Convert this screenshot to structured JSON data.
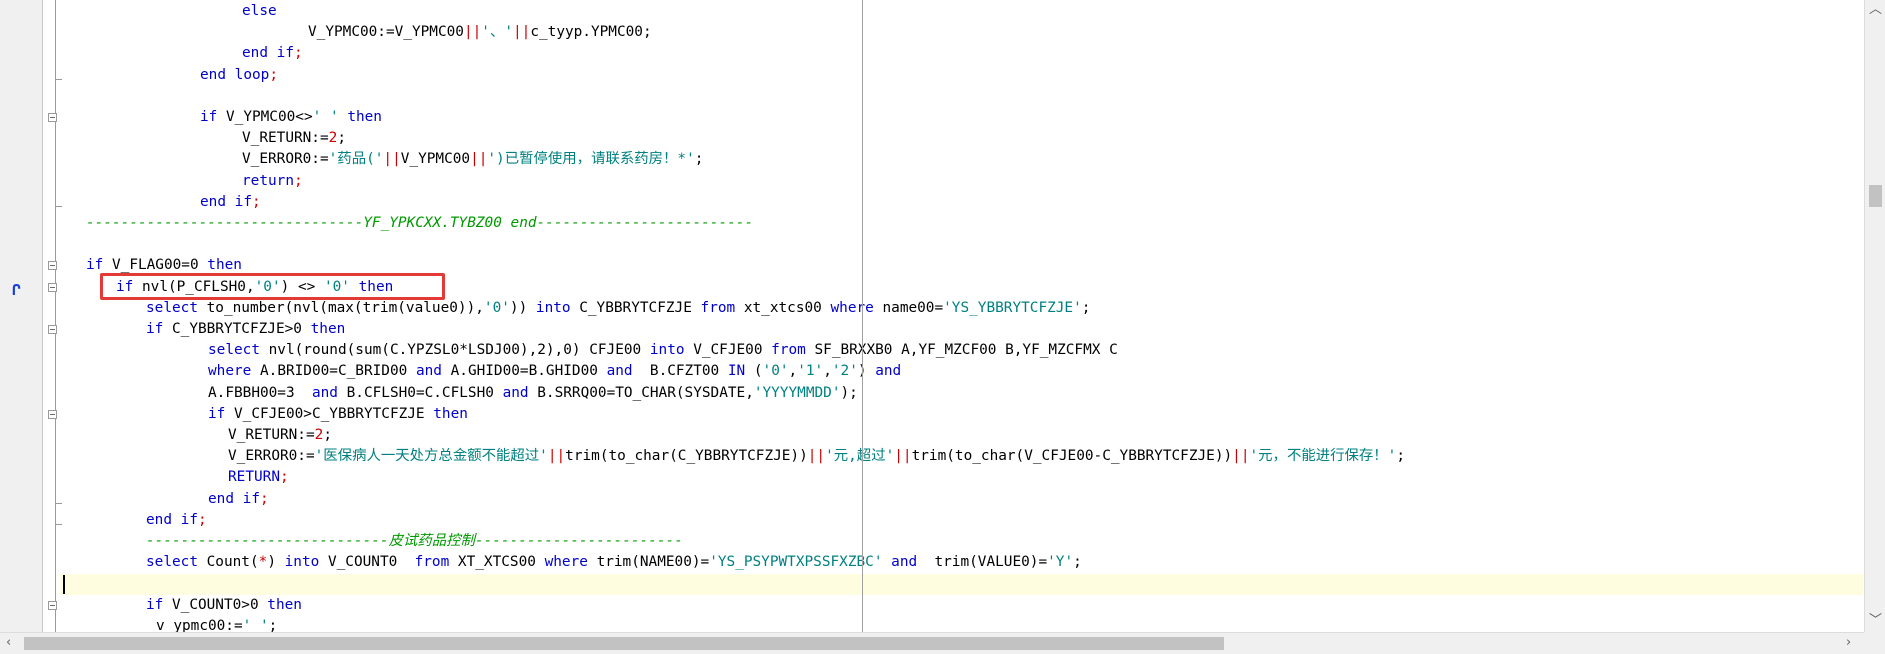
{
  "editor": {
    "colors": {
      "keyword": "#0000cc",
      "operator": "#cc0000",
      "string": "#008080",
      "comment": "#009900",
      "highlight_box": "#e53935",
      "current_line": "#fffde0"
    },
    "icons": {
      "bookmark": "bookmark-icon",
      "fold": "fold-minus-icon",
      "scroll_up": "chevron-up-icon",
      "scroll_down": "chevron-down-icon",
      "scroll_left": "chevron-left-icon",
      "scroll_right": "chevron-right-icon"
    },
    "highlighted_line_index": 13,
    "current_line_index": 27,
    "lines": [
      [
        [
          "kw",
          "else"
        ]
      ],
      [
        [
          "t",
          "V_YPMC00:=V_YPMC00"
        ],
        [
          "op",
          "||"
        ],
        [
          "str",
          "'、'"
        ],
        [
          "op",
          "||"
        ],
        [
          "t",
          "c_tyyp.YPMC00;"
        ]
      ],
      [
        [
          "kw",
          "end if"
        ],
        [
          "op",
          ";"
        ]
      ],
      [
        [
          "kw",
          "end loop"
        ],
        [
          "op",
          ";"
        ]
      ],
      [],
      [
        [
          "kw",
          "if"
        ],
        [
          "t",
          " V_YPMC00<>"
        ],
        [
          "str",
          "' '"
        ],
        [
          "t",
          " "
        ],
        [
          "kw",
          "then"
        ]
      ],
      [
        [
          "t",
          "V_RETURN:="
        ],
        [
          "op",
          "2"
        ],
        [
          "t",
          ";"
        ]
      ],
      [
        [
          "t",
          "V_ERROR0:="
        ],
        [
          "str",
          "'药品('"
        ],
        [
          "op",
          "||"
        ],
        [
          "t",
          "V_YPMC00"
        ],
        [
          "op",
          "||"
        ],
        [
          "str",
          "')已暂停使用，请联系药房！*'"
        ],
        [
          "t",
          ";"
        ]
      ],
      [
        [
          "kw",
          "return"
        ],
        [
          "op",
          ";"
        ]
      ],
      [
        [
          "kw",
          "end if"
        ],
        [
          "op",
          ";"
        ]
      ],
      [
        [
          "cm",
          "--------------------------------YF_YPKCXX.TYBZ00 end-------------------------"
        ]
      ],
      [],
      [
        [
          "kw",
          "if"
        ],
        [
          "t",
          " V_FLAG00=0 "
        ],
        [
          "kw",
          "then"
        ]
      ],
      [
        [
          "kw",
          "if"
        ],
        [
          "t",
          " nvl(P_CFLSH0,"
        ],
        [
          "str",
          "'0'"
        ],
        [
          "t",
          ") <> "
        ],
        [
          "str",
          "'0'"
        ],
        [
          "t",
          " "
        ],
        [
          "kw",
          "then"
        ]
      ],
      [
        [
          "kw",
          "select"
        ],
        [
          "t",
          " to_number(nvl(max(trim(value0)),"
        ],
        [
          "str",
          "'0'"
        ],
        [
          "t",
          ")) "
        ],
        [
          "kw",
          "into"
        ],
        [
          "t",
          " C_YBBRYTCFZJE "
        ],
        [
          "kw",
          "from"
        ],
        [
          "t",
          " xt_xtcs00 "
        ],
        [
          "kw",
          "where"
        ],
        [
          "t",
          " name00="
        ],
        [
          "str",
          "'YS_YBBRYTCFZJE'"
        ],
        [
          "t",
          ";"
        ]
      ],
      [
        [
          "kw",
          "if"
        ],
        [
          "t",
          " C_YBBRYTCFZJE>0 "
        ],
        [
          "kw",
          "then"
        ]
      ],
      [
        [
          "kw",
          "select"
        ],
        [
          "t",
          " nvl(round(sum(C.YPZSL0*LSDJ00),2),0) CFJE00 "
        ],
        [
          "kw",
          "into"
        ],
        [
          "t",
          " V_CFJE00 "
        ],
        [
          "kw",
          "from"
        ],
        [
          "t",
          " SF_BRXXB0 A,YF_MZCF00 B,YF_MZCFMX C"
        ]
      ],
      [
        [
          "kw",
          "where"
        ],
        [
          "t",
          " A.BRID00=C_BRID00 "
        ],
        [
          "kw",
          "and"
        ],
        [
          "t",
          " A.GHID00=B.GHID00 "
        ],
        [
          "kw",
          "and"
        ],
        [
          "t",
          "  B.CFZT00 "
        ],
        [
          "kw",
          "IN"
        ],
        [
          "t",
          " ("
        ],
        [
          "str",
          "'0'"
        ],
        [
          "t",
          ","
        ],
        [
          "str",
          "'1'"
        ],
        [
          "t",
          ","
        ],
        [
          "str",
          "'2'"
        ],
        [
          "t",
          ") "
        ],
        [
          "kw",
          "and"
        ]
      ],
      [
        [
          "t",
          "A.FBBH00=3  "
        ],
        [
          "kw",
          "and"
        ],
        [
          "t",
          " B.CFLSH0=C.CFLSH0 "
        ],
        [
          "kw",
          "and"
        ],
        [
          "t",
          " B.SRRQ00=TO_CHAR(SYSDATE,"
        ],
        [
          "str",
          "'YYYYMMDD'"
        ],
        [
          "t",
          ");"
        ]
      ],
      [
        [
          "kw",
          "if"
        ],
        [
          "t",
          " V_CFJE00>C_YBBRYTCFZJE "
        ],
        [
          "kw",
          "then"
        ]
      ],
      [
        [
          "t",
          "V_RETURN:="
        ],
        [
          "op",
          "2"
        ],
        [
          "t",
          ";"
        ]
      ],
      [
        [
          "t",
          "V_ERROR0:="
        ],
        [
          "str",
          "'医保病人一天处方总金额不能超过'"
        ],
        [
          "op",
          "||"
        ],
        [
          "t",
          "trim(to_char(C_YBBRYTCFZJE))"
        ],
        [
          "op",
          "||"
        ],
        [
          "str",
          "'元,超过'"
        ],
        [
          "op",
          "||"
        ],
        [
          "t",
          "trim(to_char(V_CFJE00-C_YBBRYTCFZJE))"
        ],
        [
          "op",
          "||"
        ],
        [
          "str",
          "'元，不能进行保存！'"
        ],
        [
          "t",
          ";"
        ]
      ],
      [
        [
          "kw",
          "RETURN"
        ],
        [
          "op",
          ";"
        ]
      ],
      [
        [
          "kw",
          "end if"
        ],
        [
          "op",
          ";"
        ]
      ],
      [
        [
          "kw",
          "end if"
        ],
        [
          "op",
          ";"
        ]
      ],
      [
        [
          "cm",
          "----------------------------皮试药品控制------------------------"
        ]
      ],
      [
        [
          "kw",
          "select"
        ],
        [
          "t",
          " Count("
        ],
        [
          "op",
          "*"
        ],
        [
          "t",
          ") "
        ],
        [
          "kw",
          "into"
        ],
        [
          "t",
          " V_COUNT0  "
        ],
        [
          "kw",
          "from"
        ],
        [
          "t",
          " XT_XTCS00 "
        ],
        [
          "kw",
          "where"
        ],
        [
          "t",
          " trim(NAME00)="
        ],
        [
          "str",
          "'YS_PSYPWTXPSSFXZBC'"
        ],
        [
          "t",
          " "
        ],
        [
          "kw",
          "and"
        ],
        [
          "t",
          "  trim(VALUE0)="
        ],
        [
          "str",
          "'Y'"
        ],
        [
          "t",
          ";"
        ]
      ],
      [],
      [
        [
          "kw",
          "if"
        ],
        [
          "t",
          " V_COUNT0>0 "
        ],
        [
          "kw",
          "then"
        ]
      ],
      [
        [
          "t",
          "v_ypmc00:="
        ],
        [
          "str",
          "' '"
        ],
        [
          "t",
          ";"
        ]
      ]
    ]
  }
}
